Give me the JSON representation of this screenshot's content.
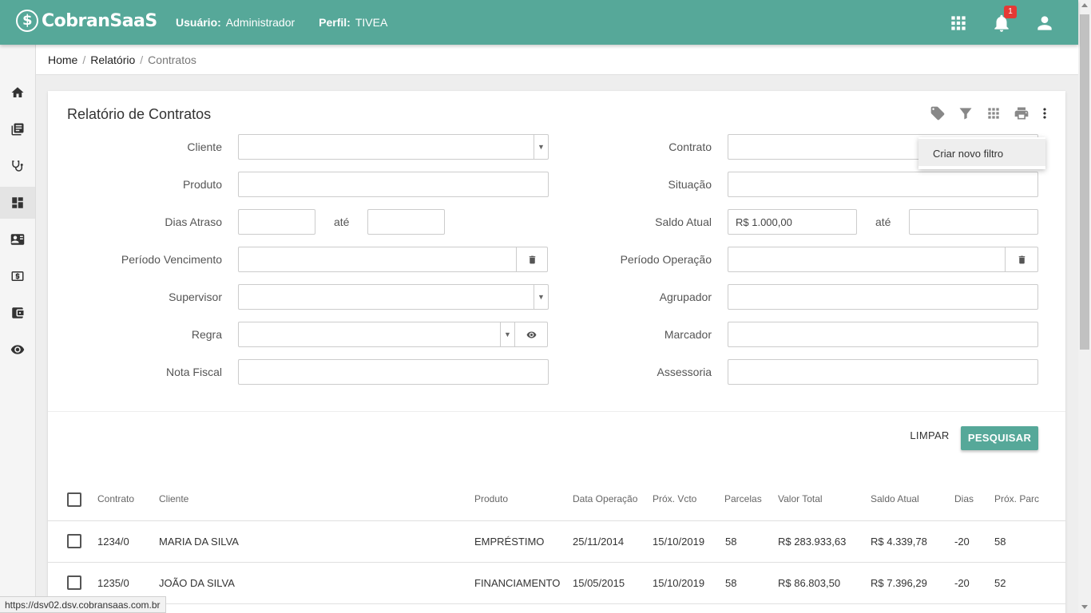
{
  "header": {
    "app_name": "CobranSaaS",
    "user_label": "Usuário:",
    "user_value": "Administrador",
    "profile_label": "Perfil:",
    "profile_value": "TIVEA",
    "notification_count": "1",
    "color": "#56a899"
  },
  "sidebar": {
    "items": [
      {
        "icon": "home-icon"
      },
      {
        "icon": "book-icon"
      },
      {
        "icon": "stethoscope-icon"
      },
      {
        "icon": "dashboard-icon",
        "active": true
      },
      {
        "icon": "contact-card-icon"
      },
      {
        "icon": "money-icon"
      },
      {
        "icon": "wallet-icon"
      },
      {
        "icon": "eye-icon"
      }
    ]
  },
  "breadcrumb": {
    "home": "Home",
    "relatorio": "Relatório",
    "current": "Contratos"
  },
  "page": {
    "title": "Relatório de Contratos",
    "menu_item": "Criar novo filtro"
  },
  "form": {
    "cliente": "Cliente",
    "produto": "Produto",
    "dias_atraso": "Dias Atraso",
    "ate": "até",
    "periodo_vencimento": "Período Vencimento",
    "supervisor": "Supervisor",
    "regra": "Regra",
    "nota_fiscal": "Nota Fiscal",
    "contrato": "Contrato",
    "situacao": "Situação",
    "saldo_atual": "Saldo Atual",
    "saldo_atual_value": "R$ 1.000,00",
    "periodo_operacao": "Período Operação",
    "agrupador": "Agrupador",
    "marcador": "Marcador",
    "assessoria": "Assessoria"
  },
  "actions": {
    "limpar": "LIMPAR",
    "pesquisar": "PESQUISAR"
  },
  "table": {
    "columns": [
      "Contrato",
      "Cliente",
      "Produto",
      "Data Operação",
      "Próx. Vcto",
      "Parcelas",
      "Valor Total",
      "Saldo Atual",
      "Dias",
      "Próx. Parc"
    ],
    "rows": [
      [
        "1234/0",
        "MARIA DA SILVA",
        "EMPRÉSTIMO",
        "25/11/2014",
        "15/10/2019",
        "58",
        "R$ 283.933,63",
        "R$ 4.339,78",
        "-20",
        "58"
      ],
      [
        "1235/0",
        "JOÃO DA SILVA",
        "FINANCIAMENTO",
        "15/05/2015",
        "15/10/2019",
        "58",
        "R$ 86.803,50",
        "R$ 7.396,29",
        "-20",
        "52"
      ]
    ]
  },
  "status_url": "https://dsv02.dsv.cobransaas.com.br"
}
